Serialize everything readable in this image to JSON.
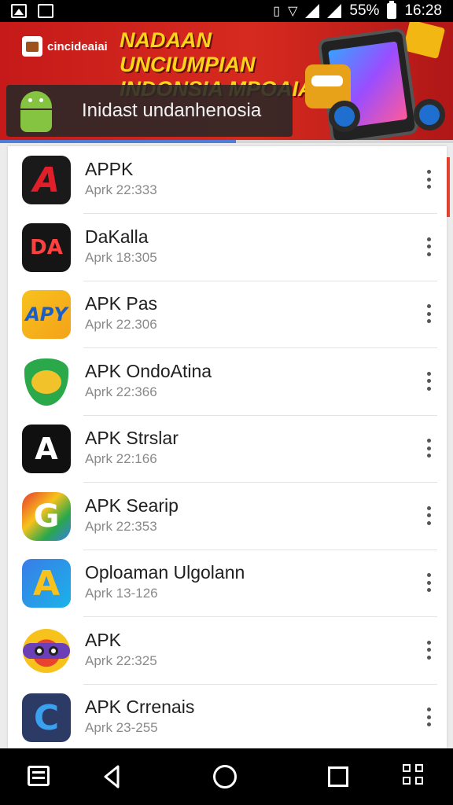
{
  "status_bar": {
    "battery": "55%",
    "time": "16:28"
  },
  "banner": {
    "brand": "cincideaiai",
    "headline": "NADAAN UNCIUMPIAN INDONSIA MPOAIA",
    "search_text": "Inidast undanhenosia"
  },
  "progress": 0.52,
  "apps": [
    {
      "name": "APPK",
      "subtitle": "Aprk 22:333",
      "icon": "app-a-icon",
      "icon_text": "A"
    },
    {
      "name": "DaKalla",
      "subtitle": "Aprk 18:305",
      "icon": "app-da-icon",
      "icon_text": "DA"
    },
    {
      "name": "APK Pas",
      "subtitle": "Aprk 22.306",
      "icon": "app-apy-icon",
      "icon_text": "APY"
    },
    {
      "name": "APK OndoAtina",
      "subtitle": "Aprk 22:366",
      "icon": "app-shield-icon",
      "icon_text": ""
    },
    {
      "name": "APK Strslar",
      "subtitle": "Aprk 22:166",
      "icon": "app-dark-icon",
      "icon_text": "A"
    },
    {
      "name": "APK Searip",
      "subtitle": "Aprk 22:353",
      "icon": "app-g-icon",
      "icon_text": "G"
    },
    {
      "name": "Oploaman Ulgolann",
      "subtitle": "Aprk 13-126",
      "icon": "app-triangle-icon",
      "icon_text": "A"
    },
    {
      "name": "APK",
      "subtitle": "Aprk 22:325",
      "icon": "app-eyes-icon",
      "icon_text": ""
    },
    {
      "name": "APK Crrenais",
      "subtitle": "Aprk 23-255",
      "icon": "app-c-icon",
      "icon_text": "C"
    }
  ]
}
